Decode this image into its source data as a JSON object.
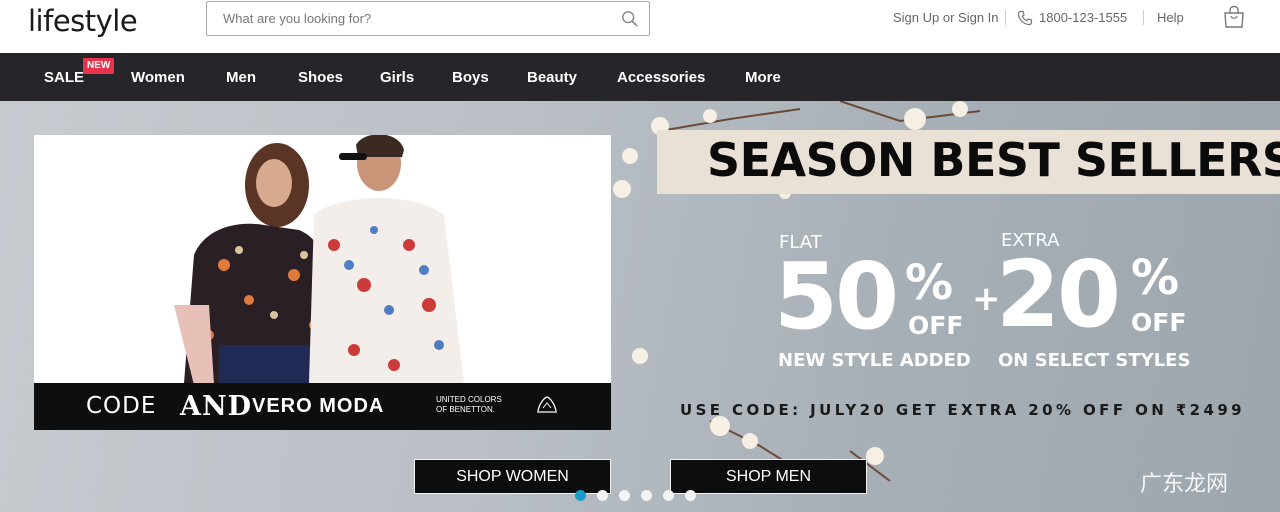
{
  "header": {
    "logo_text": "lifestyle",
    "search_placeholder": "What are you looking for?",
    "signin_label": "Sign Up or Sign In",
    "phone_label": "1800-123-1555",
    "help_label": "Help"
  },
  "nav": {
    "items": [
      {
        "label": "SALE"
      },
      {
        "label": "Women"
      },
      {
        "label": "Men"
      },
      {
        "label": "Shoes"
      },
      {
        "label": "Girls"
      },
      {
        "label": "Boys"
      },
      {
        "label": "Beauty"
      },
      {
        "label": "Accessories"
      },
      {
        "label": "More"
      }
    ],
    "new_badge": "NEW"
  },
  "banner": {
    "headline": "SEASON BEST SELLERS",
    "offer1": {
      "prefix": "FLAT",
      "value": "50",
      "unit": "%",
      "suffix": "OFF",
      "subtitle": "NEW STYLE ADDED"
    },
    "offer2": {
      "prefix": "EXTRA",
      "value": "20",
      "unit": "%",
      "suffix": "OFF",
      "subtitle": "ON SELECT STYLES"
    },
    "plus": "+",
    "promo_code": "USE CODE: JULY20 GET EXTRA 20% OFF ON ₹2499",
    "brands": [
      "CODE",
      "AND",
      "VERO MODA",
      "UNITED COLORS",
      "OF BENETTON."
    ],
    "shop_women_label": "SHOP WOMEN",
    "shop_men_label": "SHOP MEN",
    "carousel_count": 6,
    "carousel_active": 1
  },
  "watermark": "广东龙网",
  "colors": {
    "nav_bg": "#26262a",
    "badge": "#e8334a",
    "logo_dot": "#e21f4b",
    "active_dot": "#1c9bc8"
  }
}
